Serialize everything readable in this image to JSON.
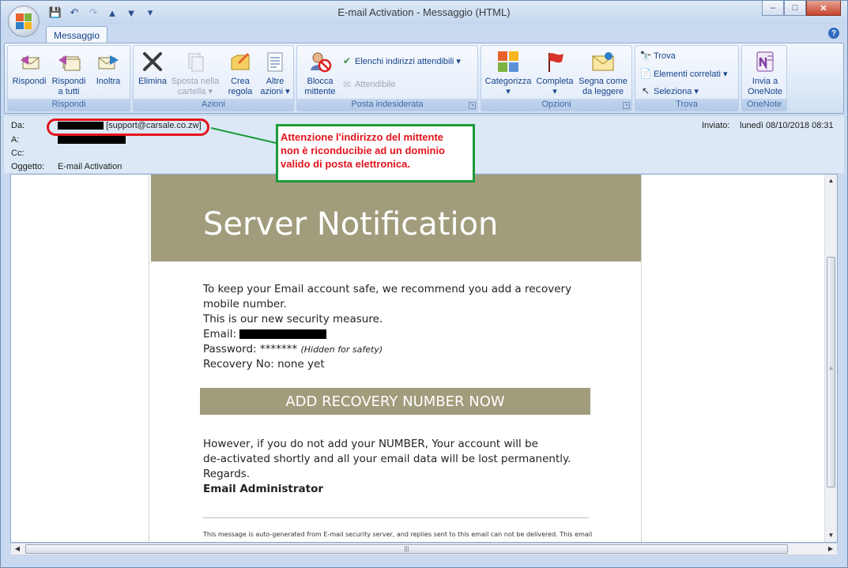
{
  "window": {
    "title": "E-mail Activation - Messaggio (HTML)",
    "min_glyph": "–",
    "max_glyph": "□",
    "close_glyph": "✕"
  },
  "quick_access": {
    "save_glyph": "💾",
    "undo_glyph": "↶",
    "redo_glyph": "↷",
    "up_glyph": "▲",
    "down_glyph": "▼",
    "more_glyph": "▾"
  },
  "ribbon": {
    "tab": "Messaggio",
    "help_glyph": "?",
    "groups": {
      "rispondi": {
        "label": "Rispondi",
        "reply": [
          "Rispondi",
          ""
        ],
        "reply_all": [
          "Rispondi",
          "a tutti"
        ],
        "forward": [
          "Inoltra",
          ""
        ]
      },
      "azioni": {
        "label": "Azioni",
        "delete": [
          "Elimina",
          ""
        ],
        "move": [
          "Sposta nella",
          "cartella ▾"
        ],
        "rule": [
          "Crea",
          "regola"
        ],
        "other": [
          "Altre",
          "azioni ▾"
        ]
      },
      "posta": {
        "label": "Posta indesiderata",
        "block": [
          "Blocca",
          "mittente"
        ],
        "safe_lists": "Elenchi indirizzi attendibili ▾",
        "trusted": "Attendibile"
      },
      "opzioni": {
        "label": "Opzioni",
        "categorize": [
          "Categorizza",
          "▾"
        ],
        "complete": [
          "Completa",
          "▾"
        ],
        "mark_read": [
          "Segna come",
          "da leggere"
        ]
      },
      "trova": {
        "label": "Trova",
        "find": "Trova",
        "related": "Elementi correlati ▾",
        "select": "Seleziona ▾"
      },
      "onenote": {
        "label": "OneNote",
        "send": [
          "Invia a",
          "OneNote"
        ]
      }
    }
  },
  "header": {
    "from_label": "Da:",
    "from_address": "[support@carsale.co.zw]",
    "to_label": "A:",
    "cc_label": "Cc:",
    "subject_label": "Oggetto:",
    "subject": "E-mail Activation",
    "sent_label": "Inviato:",
    "sent_value": "lunedì 08/10/2018 08:31"
  },
  "annotation": {
    "lines": [
      "Attenzione l'indirizzo del mittente",
      "non è riconducibie ad un dominio",
      "valido di posta elettronica."
    ],
    "color": "#e3141c",
    "border_color": "#1b9b39"
  },
  "email": {
    "banner_title": "Server Notification",
    "banner_color": "#a19c7c",
    "lines": [
      "To keep your Email account safe, we recommend you add a recovery",
      "mobile number.",
      "This is our new security measure."
    ],
    "email_label": "Email: ",
    "password_label": "Password: *******",
    "password_note": "(Hidden for safety)",
    "recovery": "Recovery No: none yet",
    "cta": "ADD RECOVERY NUMBER NOW",
    "warning_lines": [
      "However, if you do not add your NUMBER, Your account will be",
      "de-activated shortly and all your email data will be lost permanently.",
      "Regards."
    ],
    "signature": "Email Administrator",
    "footer": "This message is auto-generated from E-mail security server, and replies sent to this email can not be delivered. This email"
  },
  "scroll": {
    "up": "▲",
    "down": "▼",
    "left": "◀",
    "right": "▶",
    "grip": "≡",
    "hgrip": "|||"
  }
}
